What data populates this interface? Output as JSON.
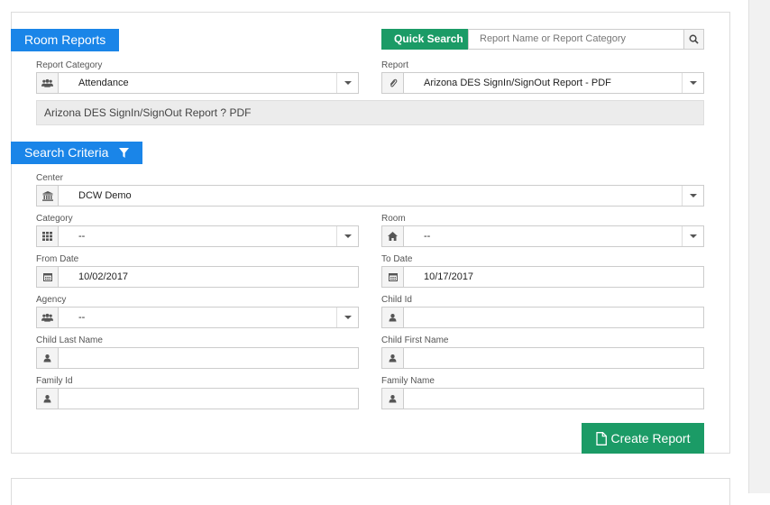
{
  "headers": {
    "room_reports": "Room Reports",
    "search_criteria": "Search Criteria"
  },
  "quick_search": {
    "label": "Quick Search",
    "placeholder": "Report Name or Report Category"
  },
  "report_category": {
    "label": "Report Category",
    "value": "Attendance"
  },
  "report": {
    "label": "Report",
    "value": "Arizona DES SignIn/SignOut Report - PDF"
  },
  "description": "Arizona DES SignIn/SignOut Report ? PDF",
  "center": {
    "label": "Center",
    "value": "DCW Demo"
  },
  "category": {
    "label": "Category",
    "value": "--"
  },
  "room": {
    "label": "Room",
    "value": "--"
  },
  "from_date": {
    "label": "From Date",
    "value": "10/02/2017"
  },
  "to_date": {
    "label": "To Date",
    "value": "10/17/2017"
  },
  "agency": {
    "label": "Agency",
    "value": "--"
  },
  "child_id": {
    "label": "Child Id",
    "value": ""
  },
  "child_last_name": {
    "label": "Child Last Name",
    "value": ""
  },
  "child_first_name": {
    "label": "Child First Name",
    "value": ""
  },
  "family_id": {
    "label": "Family Id",
    "value": ""
  },
  "family_name": {
    "label": "Family Name",
    "value": ""
  },
  "create_report": {
    "label": "Create Report"
  },
  "colors": {
    "primary_blue": "#1a85e8",
    "green": "#1b9b66"
  }
}
